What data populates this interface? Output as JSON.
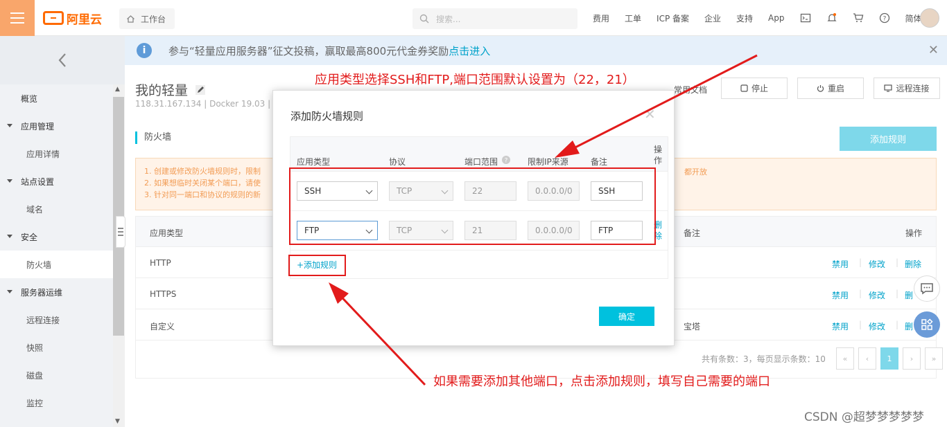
{
  "topbar": {
    "brand": "阿里云",
    "workbench": "工作台",
    "search_placeholder": "搜索...",
    "nav": [
      "费用",
      "工单",
      "ICP 备案",
      "企业",
      "支持",
      "App"
    ],
    "lang": "简体"
  },
  "sidebar": {
    "items": [
      {
        "label": "概览",
        "kind": "item"
      },
      {
        "label": "应用管理",
        "kind": "group"
      },
      {
        "label": "应用详情",
        "kind": "sub"
      },
      {
        "label": "站点设置",
        "kind": "group"
      },
      {
        "label": "域名",
        "kind": "sub"
      },
      {
        "label": "安全",
        "kind": "group"
      },
      {
        "label": "防火墙",
        "kind": "sub",
        "active": true
      },
      {
        "label": "服务器运维",
        "kind": "group"
      },
      {
        "label": "远程连接",
        "kind": "sub"
      },
      {
        "label": "快照",
        "kind": "sub"
      },
      {
        "label": "磁盘",
        "kind": "sub"
      },
      {
        "label": "监控",
        "kind": "sub"
      }
    ]
  },
  "banner": {
    "text": "参与“轻量应用服务器”征文投稿，赢取最高800元代金券奖励",
    "link": "点击进入"
  },
  "header": {
    "title": "我的轻量",
    "subtitle": "118.31.167.134 | Docker 19.03 | ",
    "doc_link": "常用文档",
    "stop": "停止",
    "restart": "重启",
    "remote": "远程连接"
  },
  "firewall": {
    "label": "防火墙",
    "add_rule": "添加规则",
    "notice_lines": [
      "1. 创建或修改防火墙规则时，限制",
      "2. 如果想临时关闭某个端口，请使",
      "3. 针对同一端口和协议的规则的新"
    ],
    "notice_tail": "都开放",
    "columns": {
      "app_type": "应用类型",
      "note": "备注",
      "ops": "操作"
    },
    "rows": [
      {
        "app": "HTTP",
        "note": "",
        "ops": [
          "禁用",
          "修改",
          "删除"
        ]
      },
      {
        "app": "HTTPS",
        "note": "",
        "ops": [
          "禁用",
          "修改",
          "删"
        ]
      },
      {
        "app": "自定义",
        "note": "宝塔",
        "ops": [
          "禁用",
          "修改",
          "删"
        ]
      }
    ],
    "footer": "共有条数：3，每页显示条数：10",
    "pager": [
      "«",
      "‹",
      "1",
      "›",
      "»"
    ]
  },
  "modal": {
    "title": "添加防火墙规则",
    "columns": [
      "应用类型",
      "协议",
      "端口范围",
      "限制IP来源",
      "备注",
      "操作"
    ],
    "rows": [
      {
        "app": "SSH",
        "protocol": "TCP",
        "port": "22",
        "ip": "0.0.0.0/0",
        "note": "SSH",
        "op": ""
      },
      {
        "app": "FTP",
        "protocol": "TCP",
        "port": "21",
        "ip": "0.0.0.0/0",
        "note": "FTP",
        "op": "删除"
      }
    ],
    "add_link": "+添加规则",
    "confirm": "确定"
  },
  "annotations": {
    "top": "应用类型选择SSH和FTP,端口范围默认设置为（22，21）",
    "bottom": "如果需要添加其他端口，点击添加规则，填写自己需要的端口",
    "color": "#e21b1b"
  },
  "watermark": "CSDN @超梦梦梦梦梦"
}
